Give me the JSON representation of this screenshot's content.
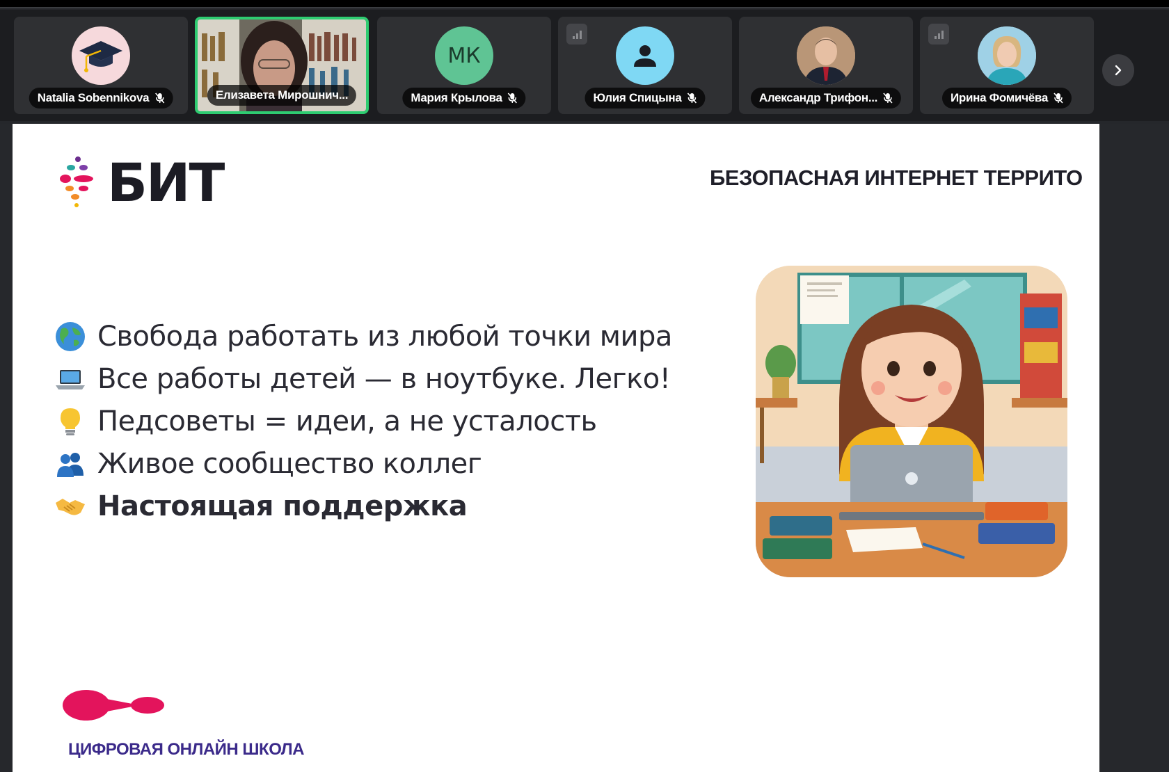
{
  "participants": [
    {
      "name": "Natalia Sobennikova",
      "avatar": "graduation-cap-avatar",
      "muted": true,
      "active": false
    },
    {
      "name": "Елизавета Мирошнич...",
      "avatar": "video",
      "muted": false,
      "active": true
    },
    {
      "name": "Мария Крылова",
      "avatar": "initials",
      "initials": "МК",
      "muted": true,
      "active": false
    },
    {
      "name": "Юлия Спицына",
      "avatar": "person-icon",
      "muted": true,
      "active": false
    },
    {
      "name": "Александр Трифон...",
      "avatar": "photo",
      "muted": true,
      "active": false
    },
    {
      "name": "Ирина Фомичёва",
      "avatar": "photo",
      "muted": true,
      "active": false
    }
  ],
  "slide": {
    "logo_text": "БИТ",
    "header_title": "БЕЗОПАСНАЯ ИНТЕРНЕТ ТЕРРИТО",
    "bullets": [
      {
        "icon": "globe-icon",
        "text": "Свобода работать из любой точки мира"
      },
      {
        "icon": "laptop-icon",
        "text": "Все работы детей — в ноутбуке. Легко!"
      },
      {
        "icon": "lightbulb-icon",
        "text": "Педсоветы = идеи, а не усталость"
      },
      {
        "icon": "people-icon",
        "text": "Живое сообщество коллег"
      },
      {
        "icon": "handshake-icon",
        "text": "Настоящая поддержка"
      }
    ],
    "footer_text": "ЦИФРОВАЯ ОНЛАЙН ШКОЛА"
  },
  "colors": {
    "active_border": "#2ecc71",
    "brand_pink": "#e3145c",
    "footer_purple": "#3b2a8a"
  }
}
